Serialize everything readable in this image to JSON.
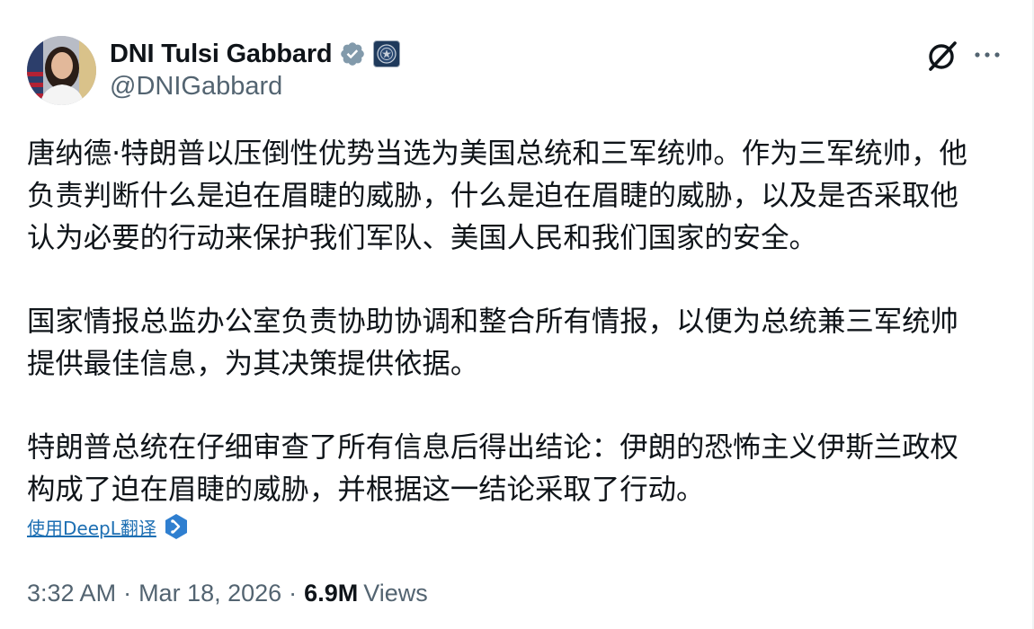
{
  "author": {
    "display_name": "DNI Tulsi Gabbard",
    "handle": "@DNIGabbard",
    "verified_badge_color": "#829aab"
  },
  "post": {
    "paragraphs": [
      "唐纳德·特朗普以压倒性优势当选为美国总统和三军统帅。作为三军统帅，他\n负责判断什么是迫在眉睫的威胁，什么是迫在眉睫的威胁，以及是否采取他\n认为必要的行动来保护我们军队、美国人民和我们国家的安全。",
      "国家情报总监办公室负责协助协调和整合所有情报，以便为总统兼三军统帅\n提供最佳信息，为其决策提供依据。",
      "特朗普总统在仔细审查了所有信息后得出结论：伊朗的恐怖主义伊斯兰政权\n构成了迫在眉睫的威胁，并根据这一结论采取了行动。"
    ],
    "translate_label": "使用DeepL翻译"
  },
  "meta": {
    "time": "3:32 AM",
    "separator": "·",
    "date": "Mar 18, 2026",
    "views_count": "6.9M",
    "views_label": "Views"
  },
  "icons": {
    "grok": "grok-icon",
    "more": "more-options-icon",
    "verified": "verified-badge-icon",
    "affiliation": "affiliation-seal-icon",
    "deepl": "deepl-icon"
  },
  "colors": {
    "text_primary": "#0f1419",
    "text_secondary": "#536471",
    "link": "#1d6fb3",
    "deepl_blue": "#2f7fd0"
  }
}
